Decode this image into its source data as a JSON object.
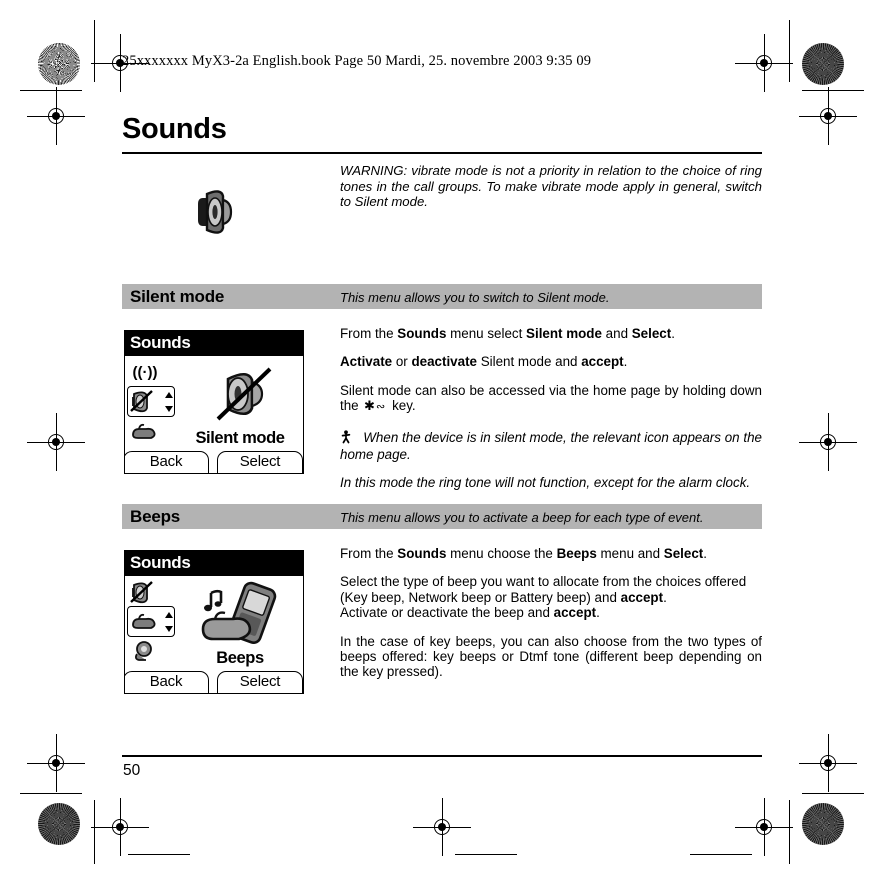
{
  "book_info": "25xxxxxxx MyX3-2a English.book  Page 50  Mardi, 25. novembre 2003  9:35 09",
  "chapter": {
    "title": "Sounds"
  },
  "warning": {
    "icon": "speaker-icon",
    "text": "WARNING: vibrate mode is not a priority in relation to the choice of ring tones in the call groups. To make vibrate mode apply in general, switch to Silent mode."
  },
  "sections": [
    {
      "name": "Silent mode",
      "description": "This menu allows you to switch to Silent mode.",
      "screenshot": {
        "title": "Sounds",
        "hero_label": "Silent mode",
        "hero_icon": "speaker-muted-icon",
        "rail_icons": [
          "network-signal-icon",
          "speaker-muted-icon",
          "hand-beep-icon"
        ],
        "selected_index": 1,
        "softkey_left": "Back",
        "softkey_right": "Select"
      },
      "paragraphs": [
        [
          {
            "t": "From the ",
            "b": false
          },
          {
            "t": "Sounds",
            "b": true
          },
          {
            "t": " menu select ",
            "b": false
          },
          {
            "t": "Silent mode",
            "b": true
          },
          {
            "t": "  and ",
            "b": false
          },
          {
            "t": "Select",
            "b": true
          },
          {
            "t": ".",
            "b": false
          }
        ],
        [
          {
            "t": "Activate",
            "b": true
          },
          {
            "t": " or ",
            "b": false
          },
          {
            "t": "deactivate",
            "b": true
          },
          {
            "t": " Silent mode and ",
            "b": false
          },
          {
            "t": "accept",
            "b": true
          },
          {
            "t": ".",
            "b": false
          }
        ],
        [
          {
            "t": "Silent mode can also be accessed via the home page by holding down the ",
            "b": false
          },
          {
            "t": "ASTERISK_KEY_ICON",
            "b": false
          },
          {
            "t": " key.",
            "b": false
          }
        ],
        [
          {
            "t": "VIBRATE_ICON",
            "b": false
          },
          {
            "t": "  When the device is in silent mode, the relevant icon appears on the home page.",
            "b": false,
            "i": true
          }
        ],
        [
          {
            "t": "In this mode the ring tone will not function, except for the alarm clock.",
            "b": false,
            "i": true
          }
        ]
      ]
    },
    {
      "name": "Beeps",
      "description": "This menu allows you to activate a beep for each type of event.",
      "screenshot": {
        "title": "Sounds",
        "hero_label": "Beeps",
        "hero_icon": "hand-phone-note-icon",
        "rail_icons": [
          "speaker-muted-icon",
          "hand-beep-icon",
          "ringer-icon"
        ],
        "selected_index": 1,
        "softkey_left": "Back",
        "softkey_right": "Select"
      },
      "paragraphs": [
        [
          {
            "t": "From the ",
            "b": false
          },
          {
            "t": "Sounds",
            "b": true
          },
          {
            "t": " menu choose the ",
            "b": false
          },
          {
            "t": "Beeps",
            "b": true
          },
          {
            "t": " menu and ",
            "b": false
          },
          {
            "t": "Select",
            "b": true
          },
          {
            "t": ".",
            "b": false
          }
        ],
        [
          {
            "t": "Select the type of beep you want to allocate from the choices offered (Key beep, Network beep or Battery beep) and ",
            "b": false
          },
          {
            "t": "accept",
            "b": true
          },
          {
            "t": ".",
            "b": false
          }
        ],
        [
          {
            "t": "Activate or deactivate the beep and ",
            "b": false
          },
          {
            "t": "accept",
            "b": true
          },
          {
            "t": ".",
            "b": false
          }
        ],
        [
          {
            "t": "In the case of key beeps, you can also choose from the two types of beeps offered: key beeps or Dtmf tone (different beep depending on the key pressed).",
            "b": false
          }
        ]
      ]
    }
  ],
  "footer": {
    "page_number": "50"
  },
  "colors": {
    "section_bar": "#b3b3b3",
    "text": "#000000",
    "background": "#ffffff"
  }
}
